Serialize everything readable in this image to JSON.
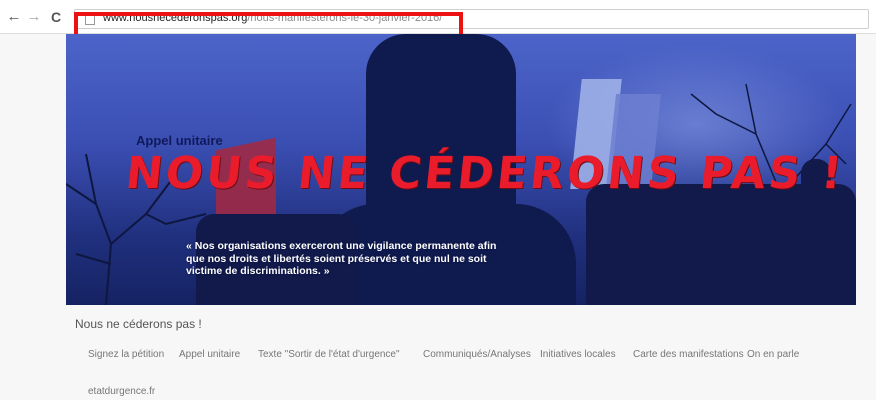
{
  "browser": {
    "url_host": "www.nousnecederonspas.org",
    "url_path": "/nous-manifesterons-le-30-janvier-2016/"
  },
  "banner": {
    "kicker": "Appel unitaire",
    "headline": "NOUS NE CÉDERONS PAS !",
    "quote": "« Nos organisations exerceront une vigilance permanente afin que nos droits et libertés soient préservés et que nul ne soit victime de discriminations. »"
  },
  "site": {
    "title": "Nous ne céderons pas !"
  },
  "menu": [
    "Signez la pétition",
    "Appel unitaire",
    "Texte \"Sortir de l'état d'urgence\"",
    "Communiqués/Analyses",
    "Initiatives locales",
    "Carte des manifestations",
    "On en parle",
    "etatdurgence.fr"
  ],
  "colors": {
    "headline": "#ea1c2b",
    "highlight": "#ee1111",
    "banner_blue": "#3b4fb3"
  }
}
